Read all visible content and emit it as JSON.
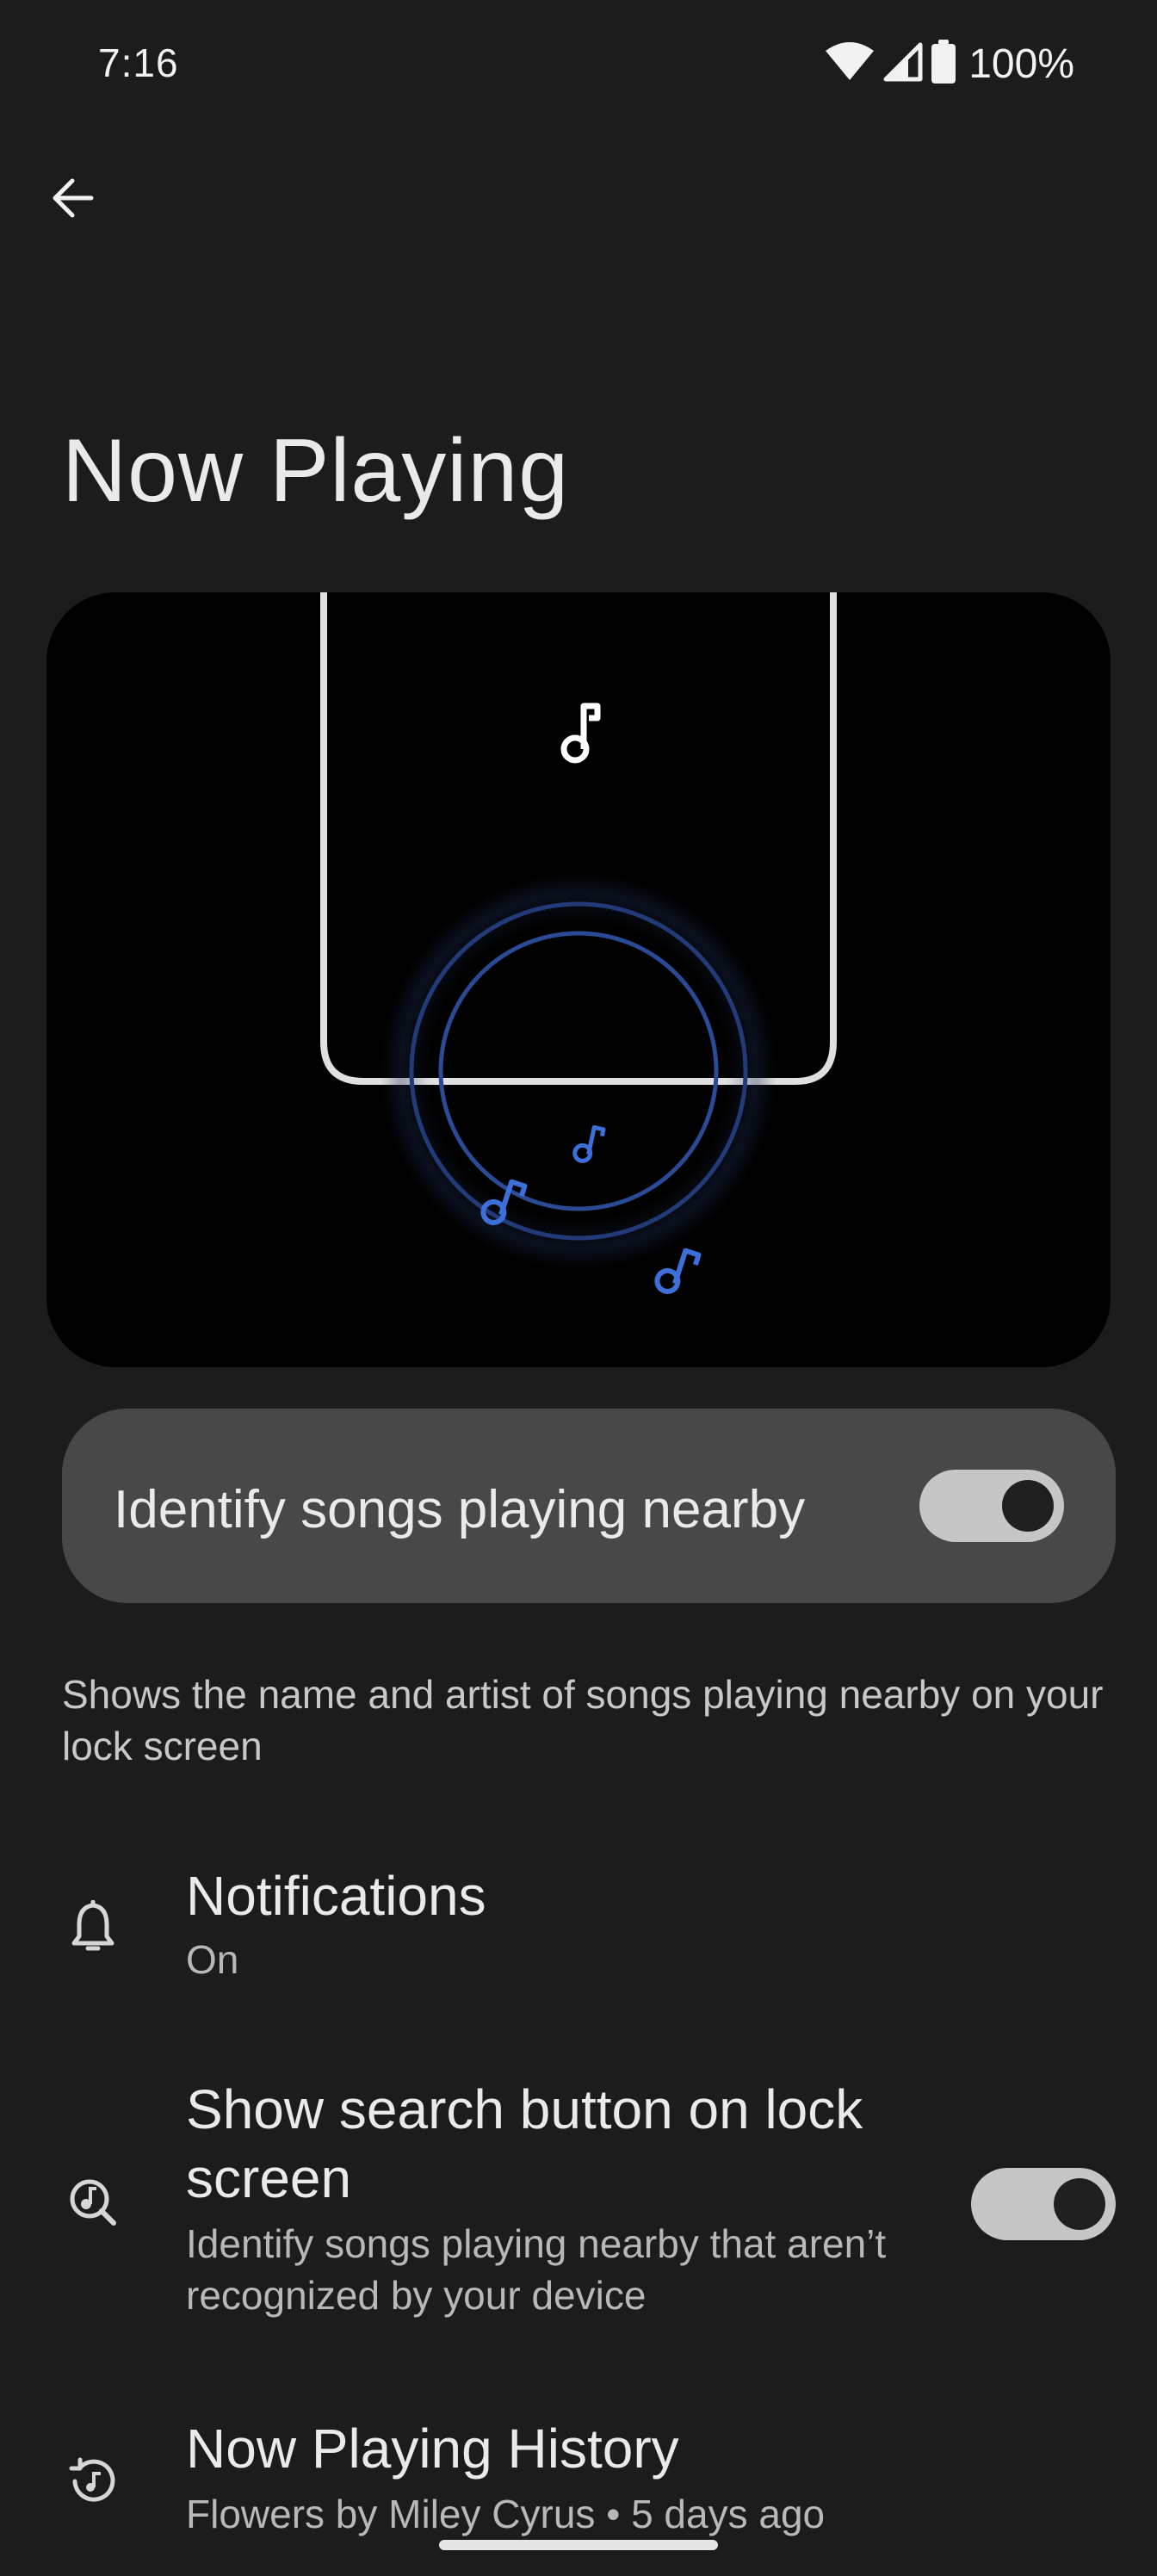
{
  "status_bar": {
    "time": "7:16",
    "battery_percent": "100%",
    "icons": [
      "wifi-icon",
      "cell-signal-icon",
      "battery-icon"
    ]
  },
  "toolbar": {
    "back_icon": "arrow-back-icon"
  },
  "page": {
    "title": "Now Playing"
  },
  "main_toggle": {
    "label": "Identify songs playing nearby",
    "on": true
  },
  "description": "Shows the name and artist of songs playing nearby on your lock screen",
  "settings": [
    {
      "icon": "bell-icon",
      "title": "Notifications",
      "subtitle": "On"
    },
    {
      "icon": "music-search-icon",
      "title": "Show search button on lock screen",
      "subtitle": "Identify songs playing nearby that aren’t recognized by your device",
      "toggle_on": true
    },
    {
      "icon": "history-icon",
      "title": "Now Playing History",
      "subtitle": "Flowers by Miley Cyrus • 5 days ago"
    }
  ],
  "colors": {
    "background": "#1c1c1c",
    "card": "#484848",
    "accent_blue": "#3d6fd9",
    "switch_track": "#c6c6c6"
  }
}
